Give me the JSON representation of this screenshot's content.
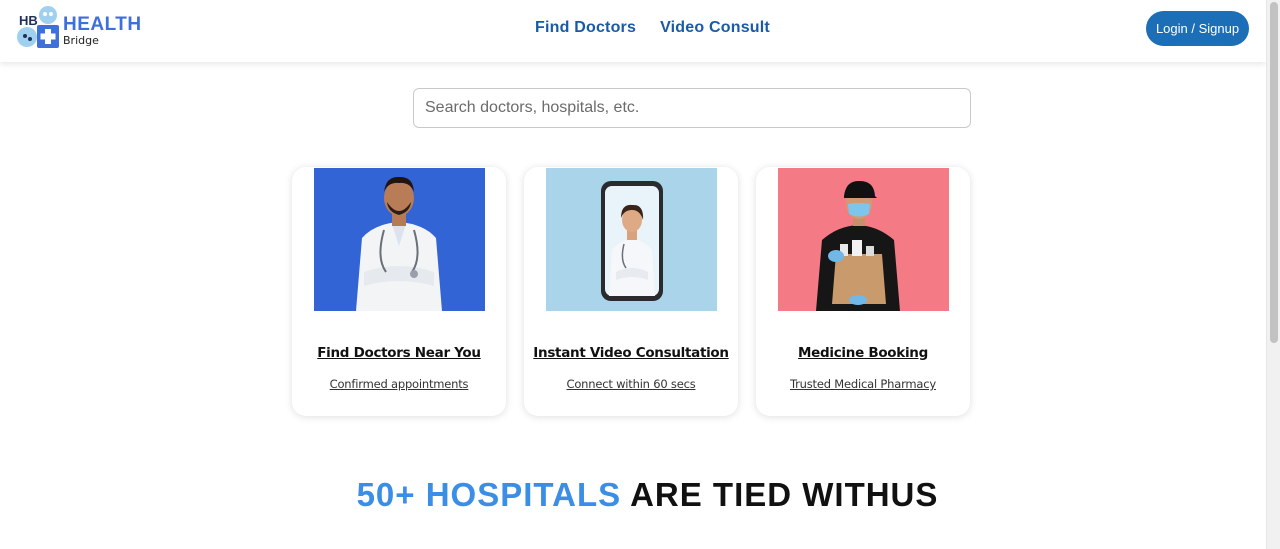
{
  "brand": {
    "mark_text": "HB",
    "name": "HEALTH",
    "sub": "Bridge",
    "primary_color": "#3f6fd8"
  },
  "nav": {
    "items": [
      "Find Doctors",
      "Video Consult"
    ],
    "color": "#1a5ba6"
  },
  "header": {
    "login_label": "Login / Signup",
    "login_color": "#1c6fb6"
  },
  "search": {
    "placeholder": "Search doctors, hospitals, etc.",
    "value": ""
  },
  "cards": [
    {
      "title": "Find Doctors Near You",
      "subtitle": "Confirmed appointments",
      "image": "doctor-photo",
      "bg": "#2f5fcf"
    },
    {
      "title": "Instant Video Consultation",
      "subtitle": "Connect within 60 secs",
      "image": "video-consult-photo",
      "bg": "#a9d4ea"
    },
    {
      "title": "Medicine Booking",
      "subtitle": "Trusted Medical Pharmacy",
      "image": "delivery-photo",
      "bg": "#f47a85"
    }
  ],
  "tied_heading": {
    "highlight": "50+ HOSPITALS",
    "rest": "ARE TIED WITHUS",
    "highlight_color": "#3a8ee6"
  }
}
